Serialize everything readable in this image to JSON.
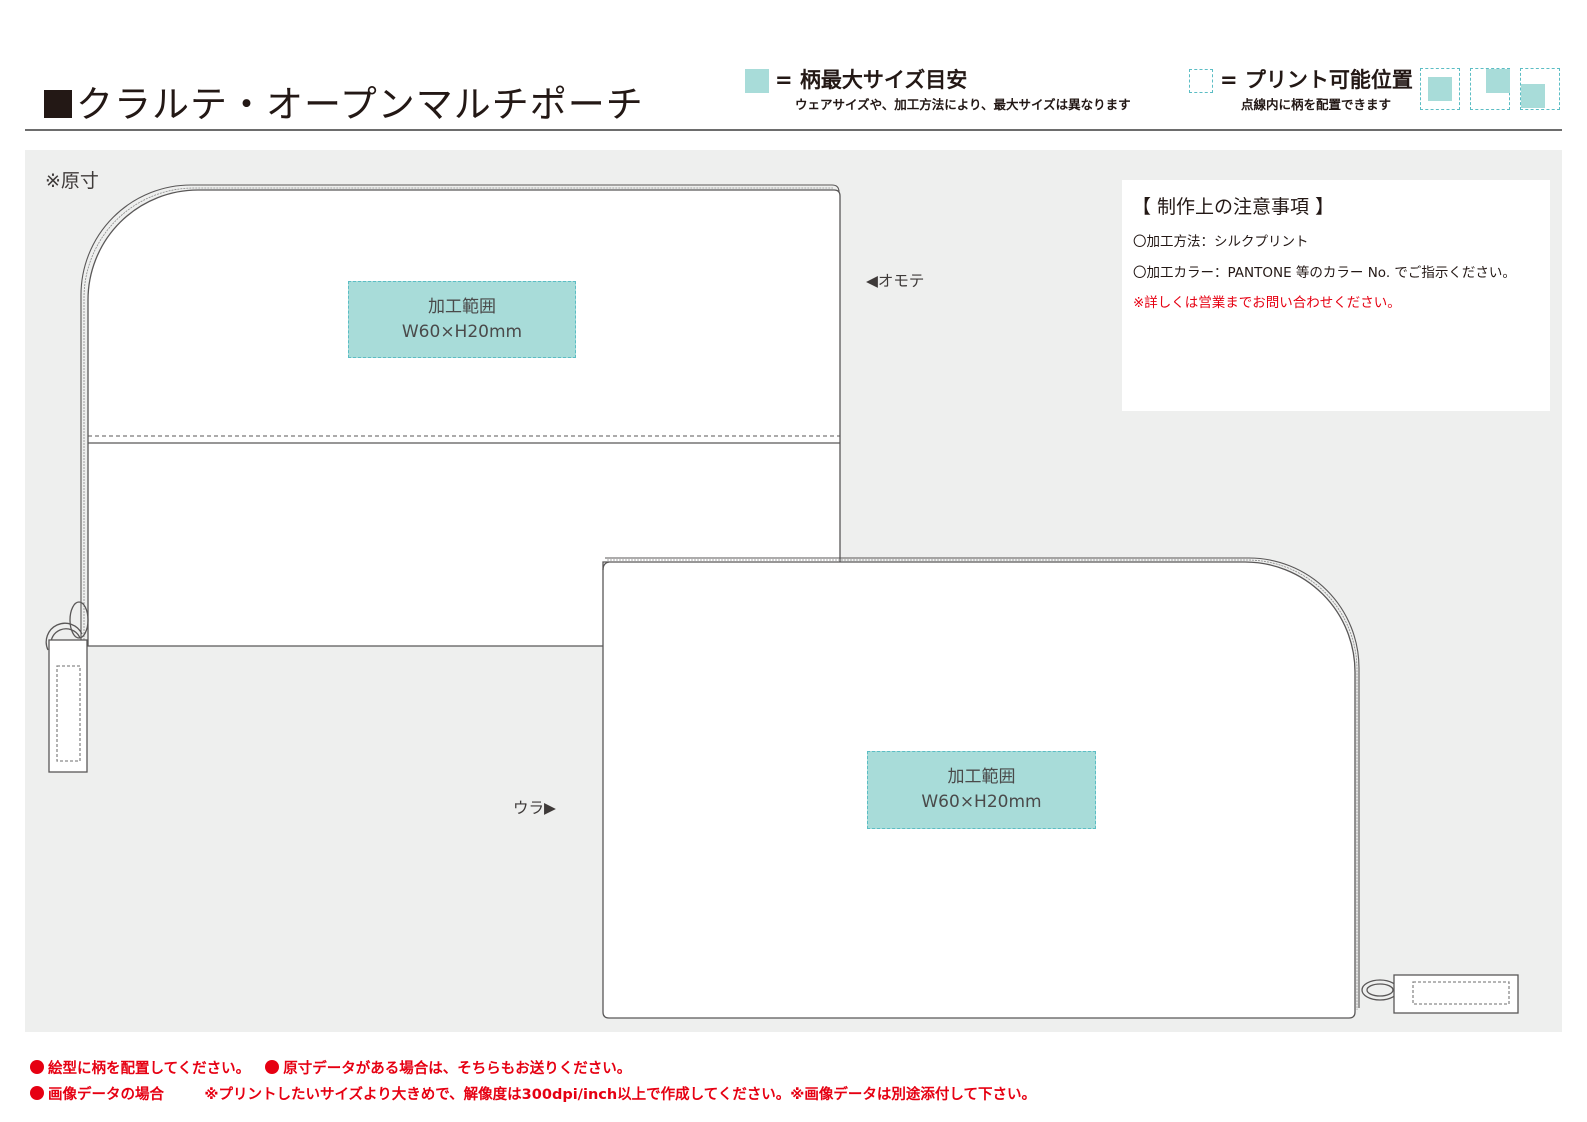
{
  "header": {
    "title": "クラルテ・オープンマルチポーチ",
    "legend_max": {
      "label": "= 柄最大サイズ目安",
      "note": "ウェアサイズや、加工方法により、最大サイズは異なります",
      "color": "#a8dcd9"
    },
    "legend_print": {
      "label": "= プリント可能位置",
      "note": "点線内に柄を配置できます",
      "color": "#5bbdc4"
    },
    "position_icons": [
      "position-center-icon",
      "position-top-right-icon",
      "position-bottom-right-icon"
    ]
  },
  "canvas": {
    "actual_size_label": "※原寸",
    "front": {
      "side_label": "◀オモテ",
      "area_title": "加工範囲",
      "area_size": "W60×H20mm"
    },
    "back": {
      "side_label": "ウラ▶",
      "area_title": "加工範囲",
      "area_size": "W60×H20mm"
    }
  },
  "notes": {
    "title": "【 制作上の注意事項 】",
    "method": "〇加工方法：シルクプリント",
    "color": "〇加工カラー：PANTONE 等のカラー No. でご指示ください。",
    "contact": "※詳しくは営業までお問い合わせください。"
  },
  "footer": {
    "line1_a": "絵型に柄を配置してください。",
    "line1_b": "原寸データがある場合は、そちらもお送りください。",
    "line2_a": "画像データの場合",
    "line2_b": "※プリントしたいサイズより大きめで、解像度は300dpi/inch以上で作成してください。※画像データは別途添付して下さい。"
  },
  "colors": {
    "print_area": "#a8dcd9",
    "dashed_border": "#5bbdc4",
    "panel_bg": "#eeefee",
    "warning": "#e60012"
  }
}
